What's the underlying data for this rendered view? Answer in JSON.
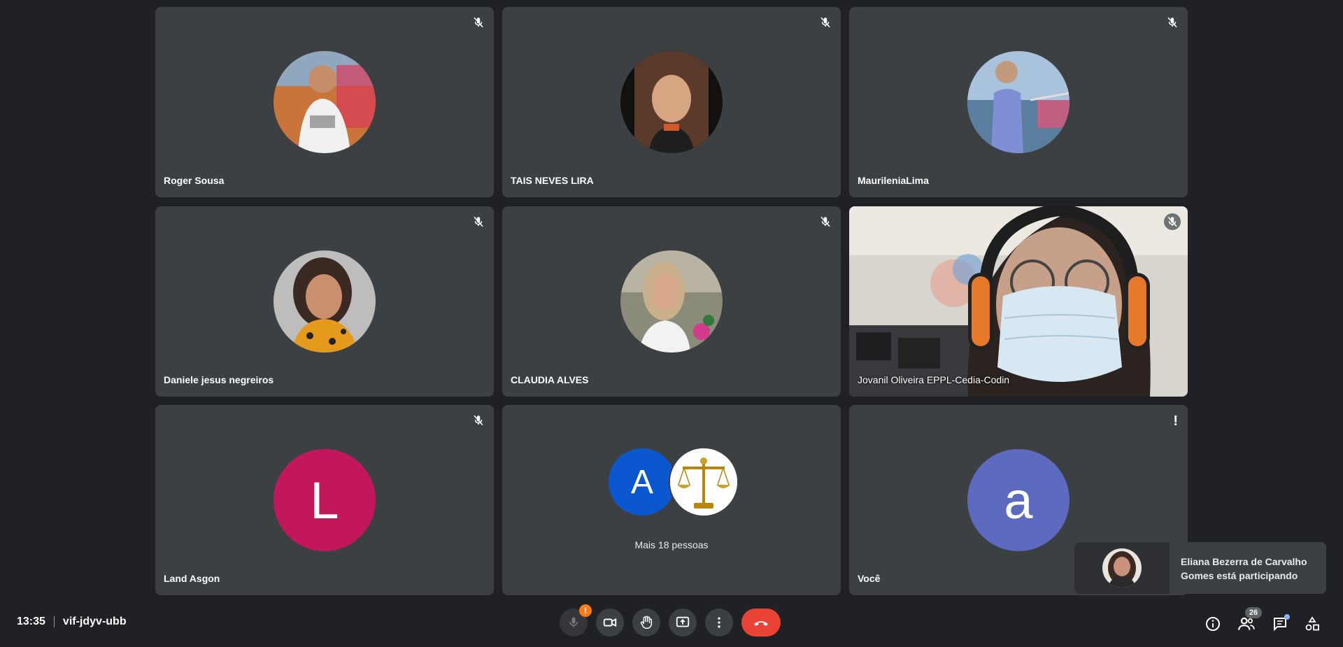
{
  "participants": [
    {
      "name": "Roger Sousa"
    },
    {
      "name": "TAIS NEVES LIRA"
    },
    {
      "name": "MaurileniaLima"
    },
    {
      "name": "Daniele jesus negreiros"
    },
    {
      "name": "CLAUDIA ALVES"
    },
    {
      "name": "Jovanil Oliveira EPPL-Cedia-Codin"
    },
    {
      "name": "Land Asgon",
      "initial": "L",
      "color": "#c2185b"
    },
    {
      "name": "Você",
      "initial": "a",
      "color": "#5c6bc0"
    }
  ],
  "group_tile": {
    "initial": "A",
    "initial_color": "#0b57d0",
    "label": "Mais 18 pessoas"
  },
  "meeting": {
    "time": "13:35",
    "code": "vif-jdyv-ubb"
  },
  "controls": {
    "mic_alert": "!",
    "participant_count": "26"
  },
  "toast": {
    "message": "Eliana Bezerra de Carvalho Gomes está participando"
  },
  "alert_marker": "!",
  "colors": {
    "background": "#202124",
    "tile": "#3c4043",
    "end_call": "#ea4335",
    "warning": "#fa7b17"
  },
  "icons": [
    "mic-off-icon",
    "camera-icon",
    "hand-icon",
    "present-icon",
    "more-options-icon",
    "end-call-icon",
    "info-icon",
    "people-icon",
    "chat-icon",
    "activities-icon",
    "alert-icon"
  ]
}
